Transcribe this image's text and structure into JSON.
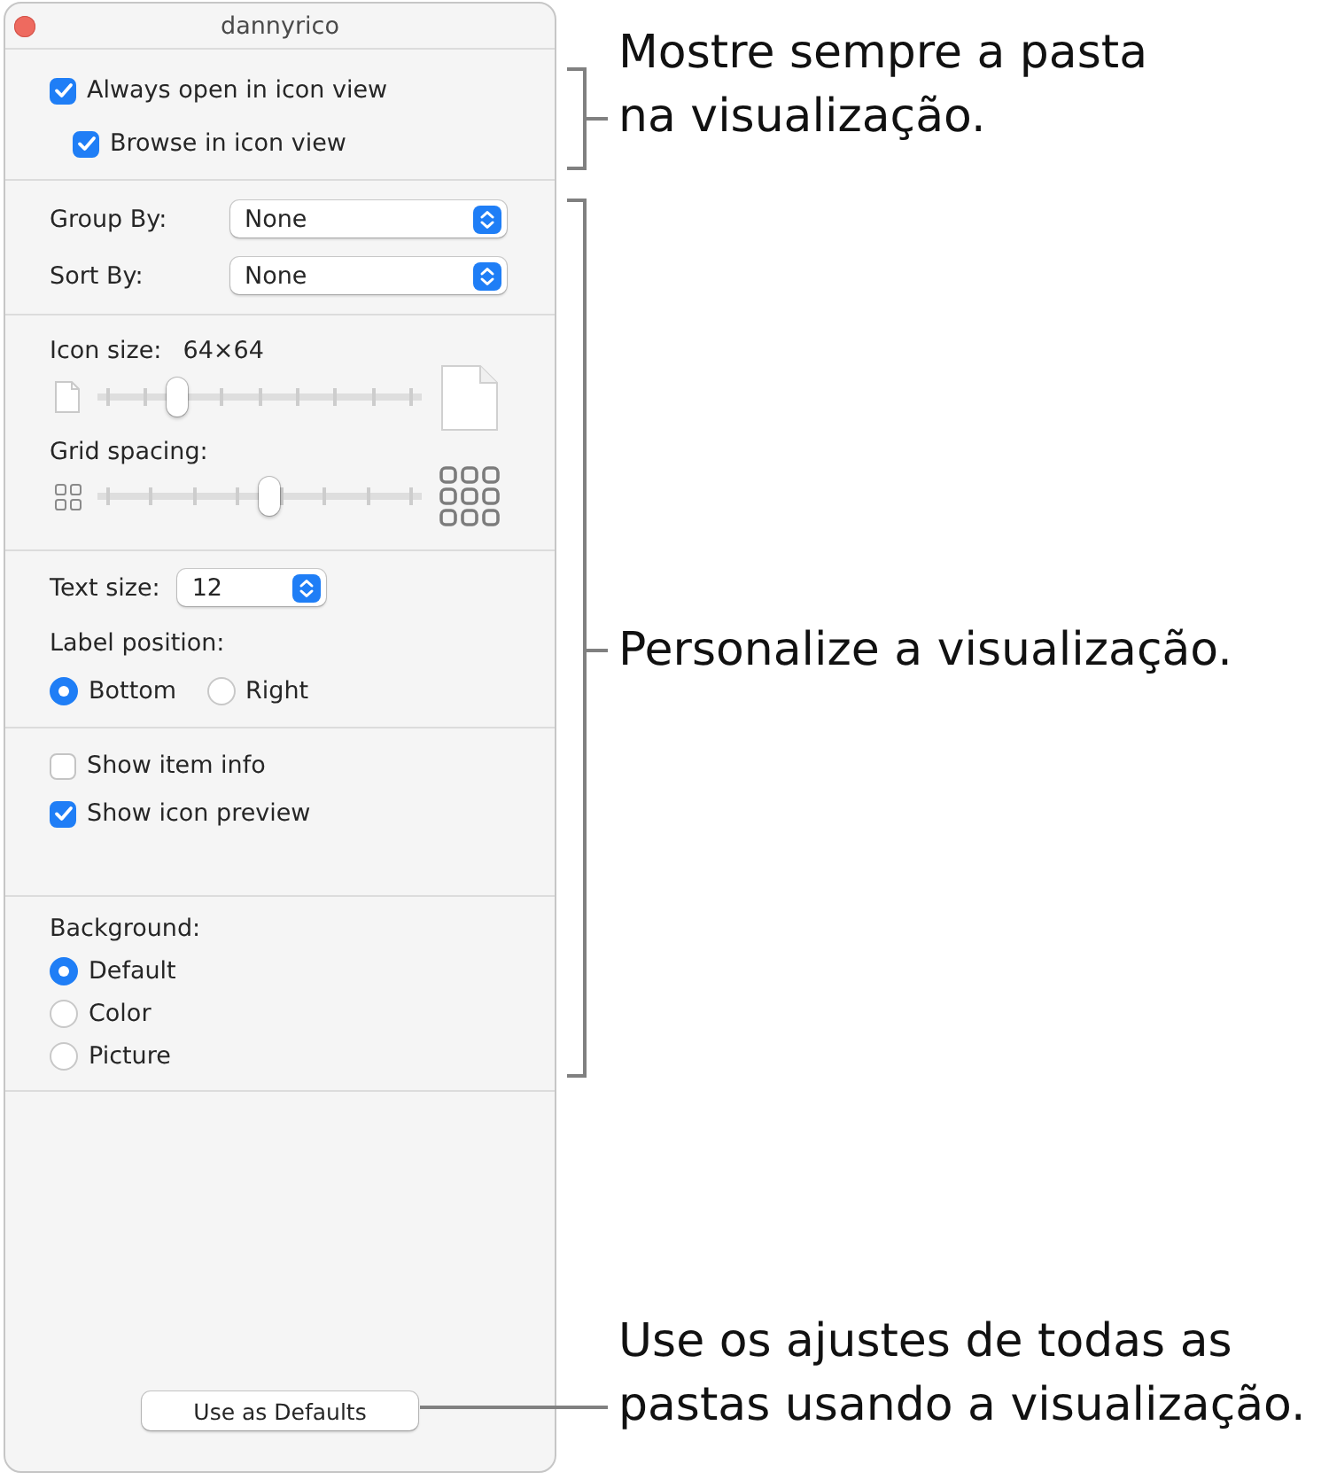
{
  "window": {
    "title": "dannyrico"
  },
  "open_options": [
    {
      "label": "Always open in icon view",
      "checked": true,
      "children": [
        {
          "label": "Browse in icon view",
          "checked": true
        }
      ]
    }
  ],
  "arrangement": [
    {
      "label": "Group By:",
      "value": "None"
    },
    {
      "label": "Sort By:",
      "value": "None"
    }
  ],
  "sliders": [
    {
      "kind": "size",
      "label": "Icon size:",
      "value": "64×64",
      "level": 0.23
    },
    {
      "kind": "grid",
      "label": "Grid spacing:",
      "level": 0.53
    }
  ],
  "text_size": {
    "label": "Text size:",
    "value": "12"
  },
  "label_position": {
    "label": "Label position:",
    "options": [
      {
        "label": "Bottom",
        "selected": true
      },
      {
        "label": "Right",
        "selected": false
      }
    ]
  },
  "item_options": [
    {
      "label": "Show item info",
      "checked": false
    },
    {
      "label": "Show icon preview",
      "checked": true
    }
  ],
  "background": {
    "label": "Background:",
    "options": [
      {
        "label": "Default",
        "selected": true
      },
      {
        "label": "Color",
        "selected": false
      },
      {
        "label": "Picture",
        "selected": false
      }
    ]
  },
  "defaults_button": {
    "label": "Use as Defaults"
  },
  "callouts": [
    {
      "kind": "bracket",
      "text": "Mostre sempre a pasta na visualização."
    },
    {
      "kind": "bracket",
      "text": "Personalize a visualização."
    },
    {
      "kind": "leader",
      "text": "Use os ajustes de todas as pastas usando a visualização."
    }
  ]
}
